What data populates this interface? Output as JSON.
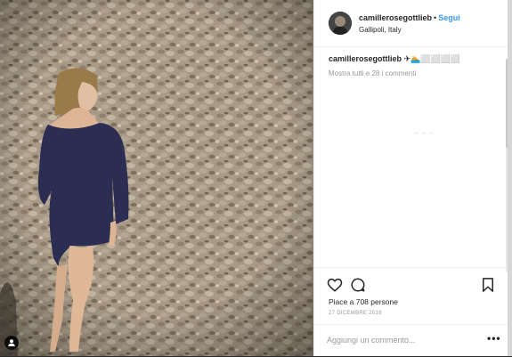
{
  "post": {
    "username": "camillerosegottlieb",
    "separator": "•",
    "follow_label": "Segui",
    "location": "Gallipoli, Italy",
    "caption_text": "✈🏊⬜⬜⬜⬜",
    "view_comments": "Mostra tutti e 28 i commenti",
    "loading_text": "– – –",
    "likes": "Piace a 708 persone",
    "date": "27 DICEMBRE 2016"
  },
  "comment_box": {
    "placeholder": "Aggiungi un commento..."
  },
  "more_options": "•••",
  "icons": {
    "like": "heart-icon",
    "comment": "speech-bubble-icon",
    "save": "bookmark-icon",
    "user_tag": "person-icon"
  },
  "colors": {
    "link": "#3897f0",
    "text": "#262626",
    "muted": "#999999",
    "dress": "#2b2e52"
  }
}
